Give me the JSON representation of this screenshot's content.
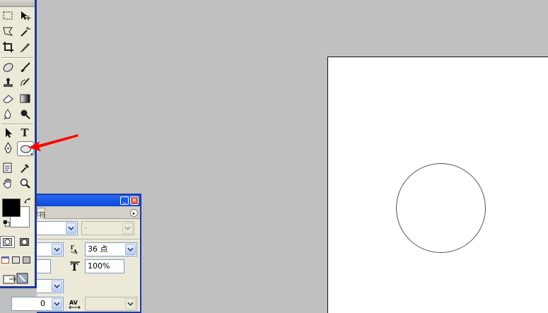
{
  "toolbox": {
    "type_tool_label": "T"
  },
  "character_panel": {
    "tab_label": "字符",
    "menu_glyph": "▸",
    "font_style_value": "-",
    "font_size_value": "36 点",
    "vertical_scale_value": "100%",
    "kerning_value": "0"
  },
  "colors": {
    "arrow": "#ff0000",
    "titlebar": "#0a48d8",
    "canvas_bg": "#ffffff",
    "workspace_bg": "#c0c0c0"
  }
}
